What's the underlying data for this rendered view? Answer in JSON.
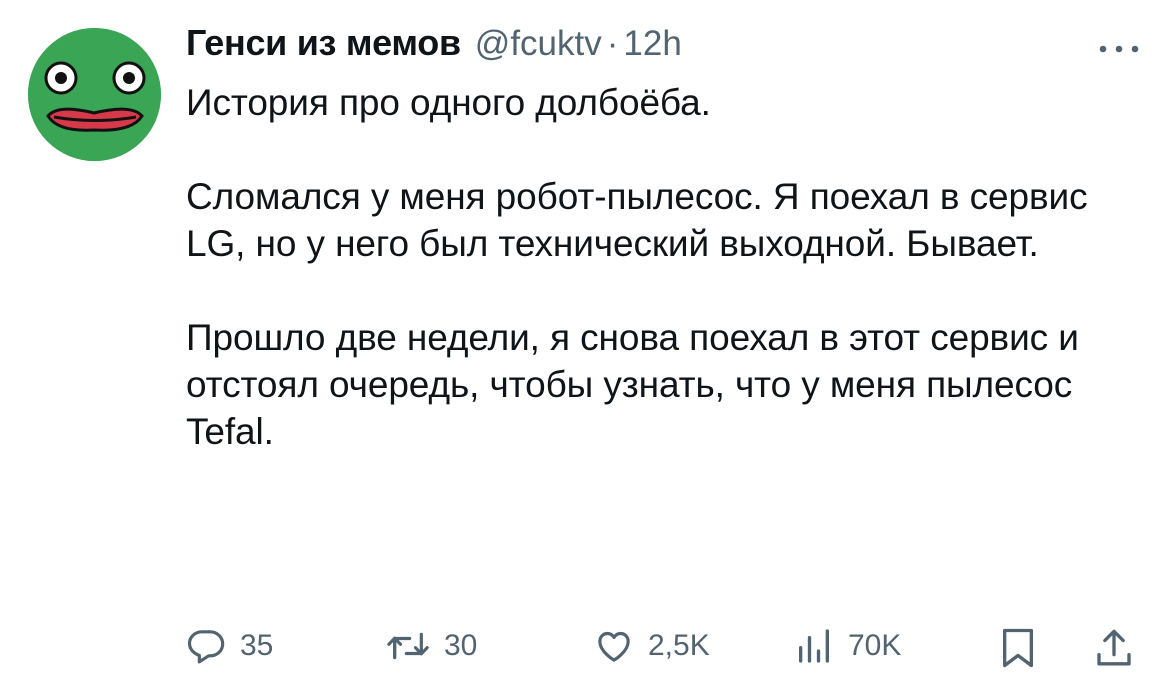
{
  "author": {
    "display_name": "Генси из мемов",
    "handle": "@fcuktv",
    "separator": "·",
    "time": "12h",
    "avatar_icon": "frog-face-avatar"
  },
  "tweet": {
    "text": "История про одного долбоёба.\n\nСломался у меня робот-пылесос. Я поехал в сервис LG, но у него был технический выходной. Бывает.\n\nПрошло две недели, я снова поехал в этот сервис и отстоял очередь, чтобы узнать, что у меня пылесос Tefal."
  },
  "actions": {
    "reply": {
      "icon": "reply-icon",
      "count": "35"
    },
    "retweet": {
      "icon": "retweet-icon",
      "count": "30"
    },
    "like": {
      "icon": "heart-icon",
      "count": "2,5K"
    },
    "views": {
      "icon": "analytics-icon",
      "count": "70K"
    },
    "bookmark": {
      "icon": "bookmark-icon"
    },
    "share": {
      "icon": "share-icon"
    }
  },
  "colors": {
    "text": "#0f1419",
    "secondary": "#536471",
    "avatar_bg": "#3aa655"
  }
}
